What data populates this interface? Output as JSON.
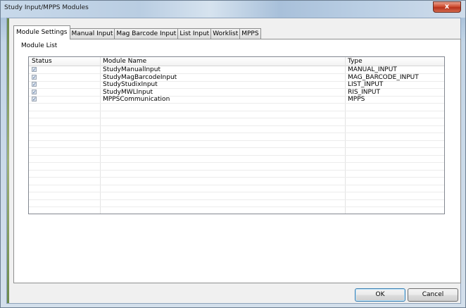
{
  "window": {
    "title": "Study Input/MPPS Modules",
    "close_glyph": "x"
  },
  "tabs": [
    {
      "label": "Module Settings",
      "active": true
    },
    {
      "label": "Manual Input",
      "active": false
    },
    {
      "label": "Mag Barcode Input",
      "active": false
    },
    {
      "label": "List Input",
      "active": false
    },
    {
      "label": "Worklist",
      "active": false
    },
    {
      "label": "MPPS",
      "active": false
    }
  ],
  "module_list": {
    "label": "Module List",
    "columns": [
      "Status",
      "Module Name",
      "Type"
    ],
    "rows": [
      {
        "checked": true,
        "name": "StudyManualInput",
        "type": "MANUAL_INPUT"
      },
      {
        "checked": true,
        "name": "StudyMagBarcodeInput",
        "type": "MAG_BARCODE_INPUT"
      },
      {
        "checked": true,
        "name": "StudyStudixInput",
        "type": "LIST_INPUT"
      },
      {
        "checked": true,
        "name": "StudyMWLInput",
        "type": "RIS_INPUT"
      },
      {
        "checked": true,
        "name": "MPPSCommunication",
        "type": "MPPS"
      }
    ],
    "check_glyph": "✓"
  },
  "buttons": {
    "ok": "OK",
    "cancel": "Cancel"
  }
}
